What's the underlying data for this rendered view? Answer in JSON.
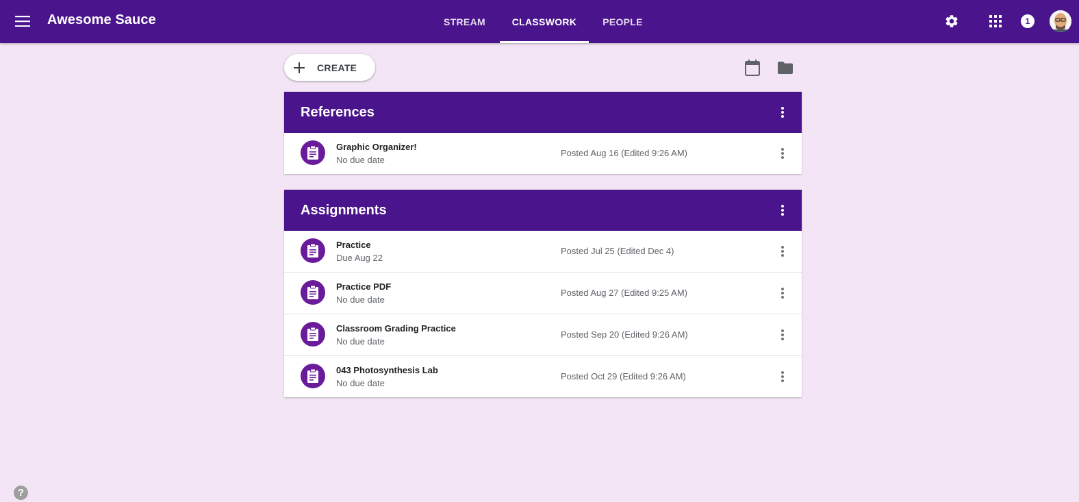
{
  "header": {
    "app_title": "Awesome Sauce",
    "tabs": [
      {
        "label": "STREAM",
        "active": false
      },
      {
        "label": "CLASSWORK",
        "active": true
      },
      {
        "label": "PEOPLE",
        "active": false
      }
    ],
    "notification_count": "1",
    "icons": [
      "menu-icon",
      "gear-icon",
      "apps-grid-icon",
      "avatar"
    ]
  },
  "toolbar": {
    "create_label": "CREATE",
    "icons": [
      "calendar-icon",
      "folder-icon"
    ]
  },
  "topics": [
    {
      "title": "References",
      "items": [
        {
          "title": "Graphic Organizer!",
          "subtitle": "No due date",
          "posted": "Posted Aug 16 (Edited 9:26 AM)"
        }
      ]
    },
    {
      "title": "Assignments",
      "items": [
        {
          "title": "Practice",
          "subtitle": "Due Aug 22",
          "posted": "Posted Jul 25 (Edited Dec 4)"
        },
        {
          "title": "Practice PDF",
          "subtitle": "No due date",
          "posted": "Posted Aug 27 (Edited 9:25 AM)"
        },
        {
          "title": "Classroom Grading Practice",
          "subtitle": "No due date",
          "posted": "Posted Sep 20 (Edited 9:26 AM)"
        },
        {
          "title": "043 Photosynthesis Lab",
          "subtitle": "No due date",
          "posted": "Posted Oct 29 (Edited 9:26 AM)"
        }
      ]
    }
  ],
  "help": {
    "label": "?"
  },
  "colors": {
    "brand": "#4a148c",
    "item_icon": "#6a1b9a",
    "background": "#f3e5f5"
  }
}
